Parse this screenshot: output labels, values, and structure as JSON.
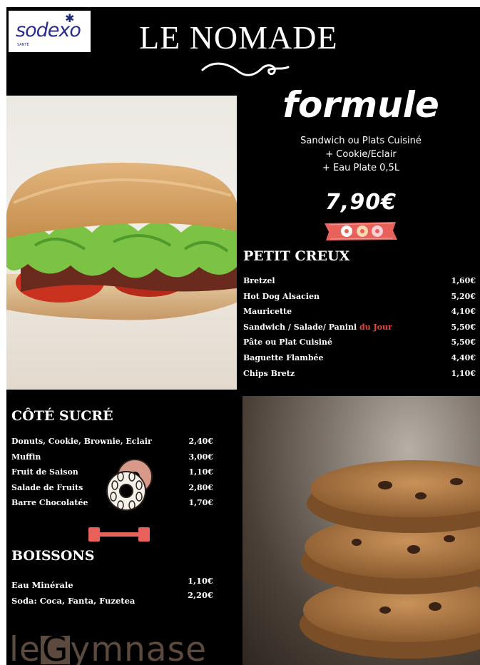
{
  "header": {
    "brand": "sodexo",
    "brand_sub": "SANTÉ",
    "title": "LE NOMADE"
  },
  "formule": {
    "title": "formule",
    "lines": [
      "Sandwich ou Plats Cuisiné",
      "+ Cookie/Eclair",
      "+ Eau Plate 0,5L"
    ],
    "price": "7,90€"
  },
  "petit_creux": {
    "title": "PETIT CREUX",
    "items": [
      {
        "name": "Bretzel",
        "price": "1,60€"
      },
      {
        "name": "Hot Dog Alsacien",
        "price": "5,20€"
      },
      {
        "name": "Mauricette",
        "price": "4,10€"
      },
      {
        "name": "Sandwich / Salade/ Panini ",
        "highlight": "du Jour",
        "price": "5,50€"
      },
      {
        "name": "Pâte ou Plat Cuisiné",
        "price": "5,50€"
      },
      {
        "name": "Baguette Flambée",
        "price": "4,40€"
      },
      {
        "name": "Chips Bretz",
        "price": "1,10€"
      }
    ]
  },
  "cote_sucre": {
    "title": "CÔTÉ SUCRÉ",
    "items": [
      {
        "name": "Donuts, Cookie, Brownie, Eclair",
        "price": "2,40€"
      },
      {
        "name": "Muffin",
        "price": "3,00€"
      },
      {
        "name": "Fruit de Saison",
        "price": "1,10€"
      },
      {
        "name": "Salade de Fruits",
        "price": "2,80€"
      },
      {
        "name": "Barre Chocolatée",
        "price": "1,70€"
      }
    ]
  },
  "boissons": {
    "title": "BOISSONS",
    "items": [
      {
        "name": "Eau Minérale",
        "price": "1,10€"
      },
      {
        "name": "Soda: Coca, Fanta, Fuzetea",
        "price": "2,20€"
      }
    ]
  },
  "footer": {
    "brand_prefix": "le",
    "brand_letter": "G",
    "brand_suffix": "ymnase"
  },
  "colors": {
    "background": "#000000",
    "highlight": "#e2463d",
    "tape": "#e8615a",
    "sodexo_blue": "#2a2f8f",
    "gymnase_brown": "#5b4a3d"
  },
  "icons": [
    "star-icon",
    "swirl-ornament",
    "donut-tape-sticker",
    "donuts-illustration",
    "bar-tape-sticker"
  ]
}
